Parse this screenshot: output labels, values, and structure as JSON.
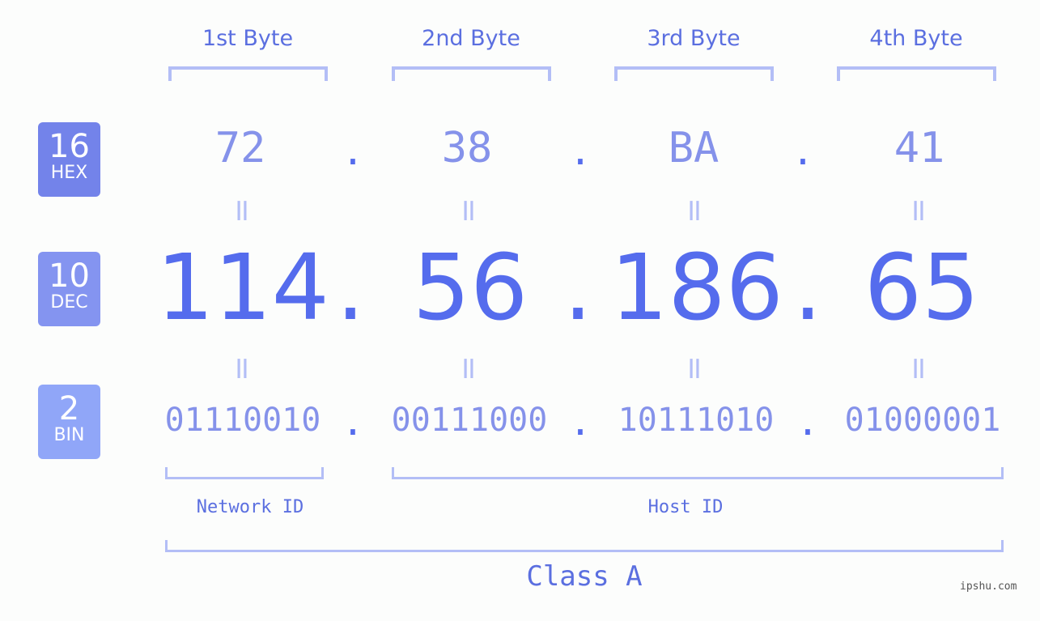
{
  "bytes": [
    {
      "header": "1st Byte",
      "hex": "72",
      "dec": "114",
      "bin": "01110010"
    },
    {
      "header": "2nd Byte",
      "hex": "38",
      "dec": "56",
      "bin": "00111000"
    },
    {
      "header": "3rd Byte",
      "hex": "BA",
      "dec": "186",
      "bin": "10111010"
    },
    {
      "header": "4th Byte",
      "hex": "41",
      "dec": "65",
      "bin": "01000001"
    }
  ],
  "badges": {
    "hex": {
      "base": "16",
      "label": "HEX",
      "color": "#7383ea"
    },
    "dec": {
      "base": "10",
      "label": "DEC",
      "color": "#8494f0"
    },
    "bin": {
      "base": "2",
      "label": "BIN",
      "color": "#90a6f8"
    }
  },
  "separator": ".",
  "equals": "=",
  "network_label": "Network ID",
  "host_label": "Host ID",
  "class_label": "Class A",
  "watermark": "ipshu.com",
  "colors": {
    "accent": "#556ced",
    "light": "#8592ea",
    "bracket": "#b3bef6"
  }
}
